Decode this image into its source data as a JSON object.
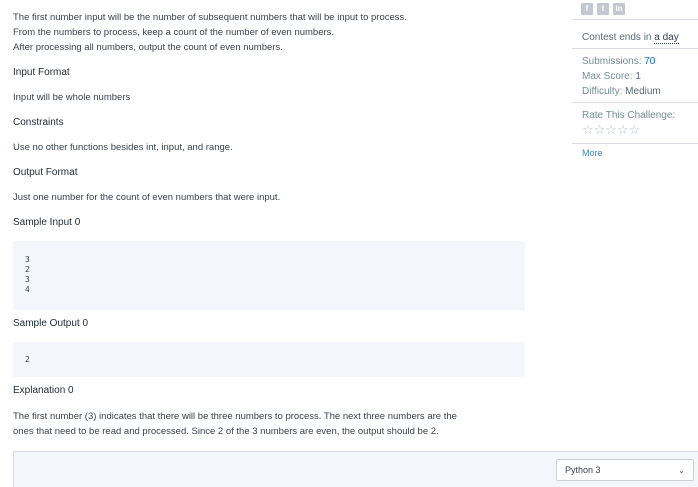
{
  "problem": {
    "intro_lines": [
      "The first number input will be the number of subsequent numbers that will be input to process.",
      "From the numbers to process, keep a count of the number of even numbers.",
      "After processing all numbers, output the count of even numbers."
    ],
    "input_format_heading": "Input Format",
    "input_format_text": "Input will be whole numbers",
    "constraints_heading": "Constraints",
    "constraints_text": "Use no other functions besides int, input, and range.",
    "output_format_heading": "Output Format",
    "output_format_text": "Just one number for the count of even numbers that were input.",
    "sample_input_heading": "Sample Input 0",
    "sample_input_lines": [
      "3",
      "2",
      "3",
      "4"
    ],
    "sample_output_heading": "Sample Output 0",
    "sample_output_lines": [
      "2"
    ],
    "explanation_heading": "Explanation 0",
    "explanation_lines": [
      "The first number (3) indicates that there will be three numbers to process. The next three numbers are the",
      "ones that need to be read and processed. Since 2 of the 3 numbers are even, the output should be 2."
    ]
  },
  "sidebar": {
    "share_icons": [
      "f",
      "t",
      "in"
    ],
    "contest_ends_prefix": "Contest ends in ",
    "contest_ends_value": "a day",
    "submissions_label": "Submissions: ",
    "submissions_value": "70",
    "max_score_label": "Max Score: ",
    "max_score_value": "1",
    "difficulty_label": "Difficulty: ",
    "difficulty_value": "Medium",
    "rate_label": "Rate This Challenge:",
    "rating_stars": "☆☆☆☆☆",
    "more_link": "More"
  },
  "editor": {
    "language": "Python 3",
    "chevron": "⌄"
  },
  "colors": {
    "text": "#39424e",
    "muted": "#738f93",
    "link": "#0e6ac0",
    "code_bg": "#f3f7fb"
  }
}
